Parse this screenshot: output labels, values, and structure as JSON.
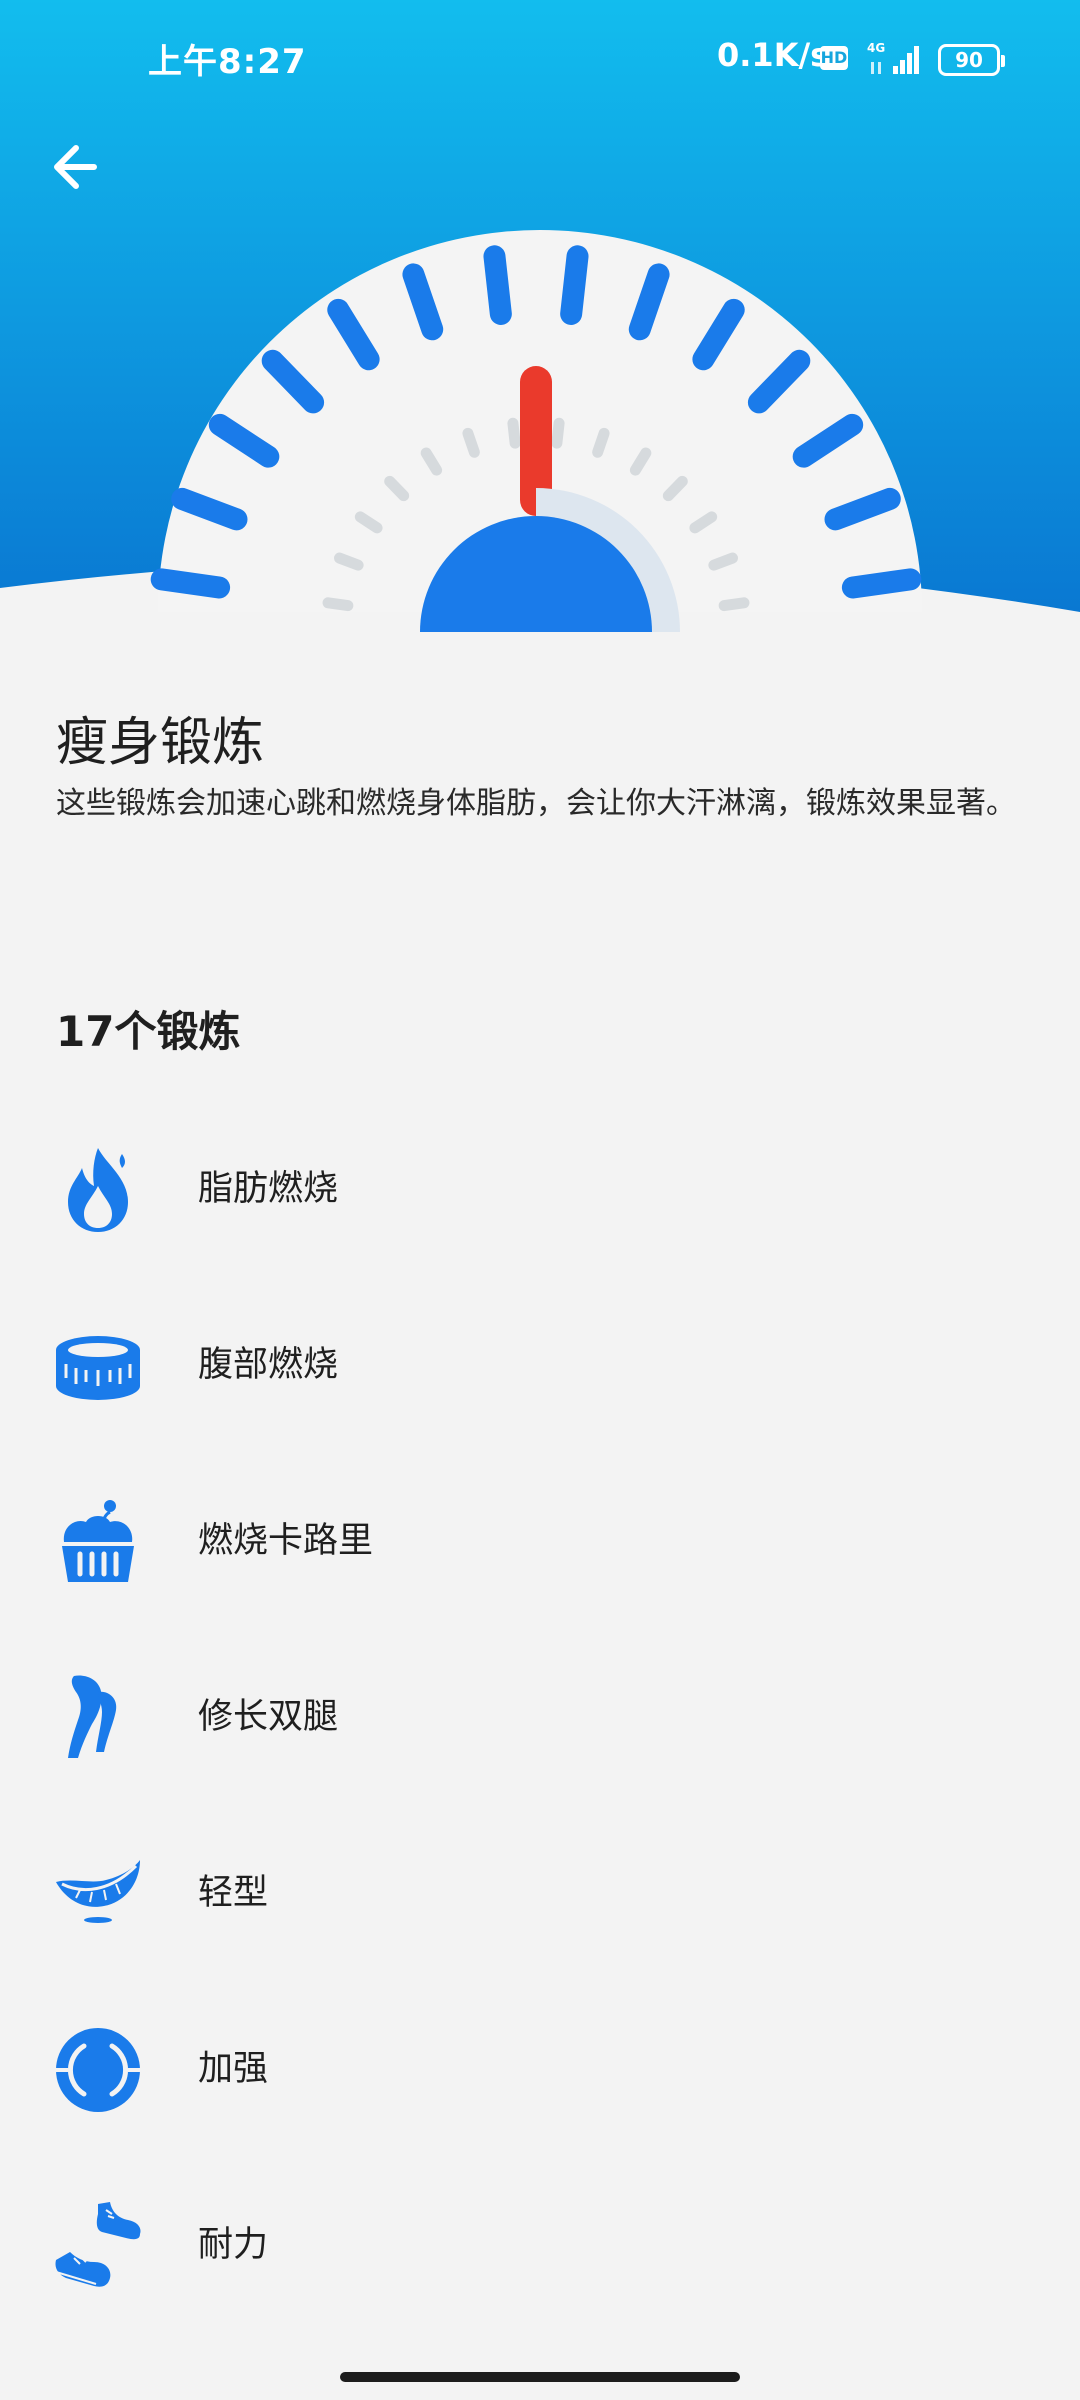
{
  "status_bar": {
    "time": "上午8:27",
    "network_speed": "0.1K/s",
    "hd_badge": "HD",
    "network_type": "4G",
    "battery_level": "90"
  },
  "header": {
    "back_icon": "arrow-left-icon",
    "gauge_icon": "intensity-gauge-icon"
  },
  "category": {
    "title": "瘦身锻炼",
    "description": "这些锻炼会加速心跳和燃烧身体脂肪，会让你大汗淋漓，锻炼效果显著。"
  },
  "workouts": {
    "count_label": "17个锻炼",
    "items": [
      {
        "label": "脂肪燃烧",
        "icon": "flame-drop-icon"
      },
      {
        "label": "腹部燃烧",
        "icon": "tape-measure-icon"
      },
      {
        "label": "燃烧卡路里",
        "icon": "cupcake-icon"
      },
      {
        "label": "修长双腿",
        "icon": "legs-icon"
      },
      {
        "label": "轻型",
        "icon": "feather-icon"
      },
      {
        "label": "加强",
        "icon": "target-circle-icon"
      },
      {
        "label": "耐力",
        "icon": "sneakers-icon"
      }
    ]
  },
  "colors": {
    "header_top": "#13b8ea",
    "header_bottom": "#0b7fd6",
    "accent_blue": "#1a7bea",
    "needle_red": "#ea3a2c",
    "background": "#f3f3f3"
  }
}
